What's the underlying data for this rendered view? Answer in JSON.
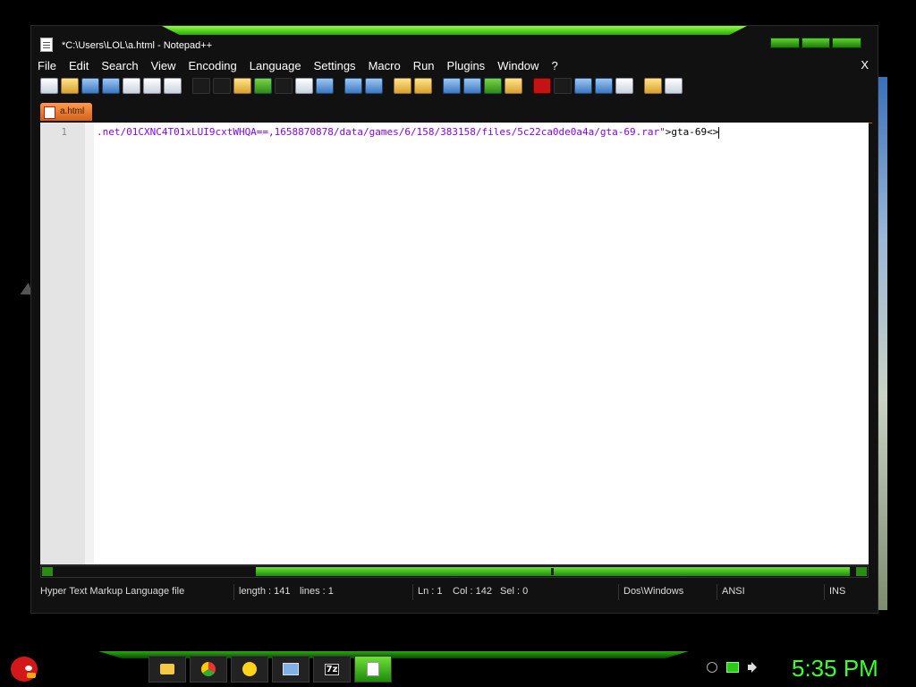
{
  "window": {
    "title": "*C:\\Users\\LOL\\a.html - Notepad++"
  },
  "menu": [
    "File",
    "Edit",
    "Search",
    "View",
    "Encoding",
    "Language",
    "Settings",
    "Macro",
    "Run",
    "Plugins",
    "Window",
    "?"
  ],
  "menu_close": "X",
  "tabs": [
    {
      "label": "a.html"
    }
  ],
  "editor": {
    "line_number": "1",
    "line_value": ".net/01CXNC4T01xLUI9cxtWHQA==,1658870878/data/games/6/158/383158/files/5c22ca0de0a4a/gta-69.rar\"",
    "line_tail": ">gta-69<>"
  },
  "status": {
    "filetype": "Hyper Text Markup Language file",
    "length": "length : 141",
    "lines": "lines : 1",
    "ln": "Ln : 1",
    "col": "Col : 142",
    "sel": "Sel : 0",
    "eol": "Dos\\Windows",
    "encoding": "ANSI",
    "mode": "INS"
  },
  "taskbar": {
    "apps": [
      "folder-icon",
      "chrome-icon",
      "messenger-icon",
      "screen-icon",
      "7z-icon",
      "notepad-icon"
    ],
    "seven_zip_label": "7z",
    "clock": "5:35 PM"
  }
}
